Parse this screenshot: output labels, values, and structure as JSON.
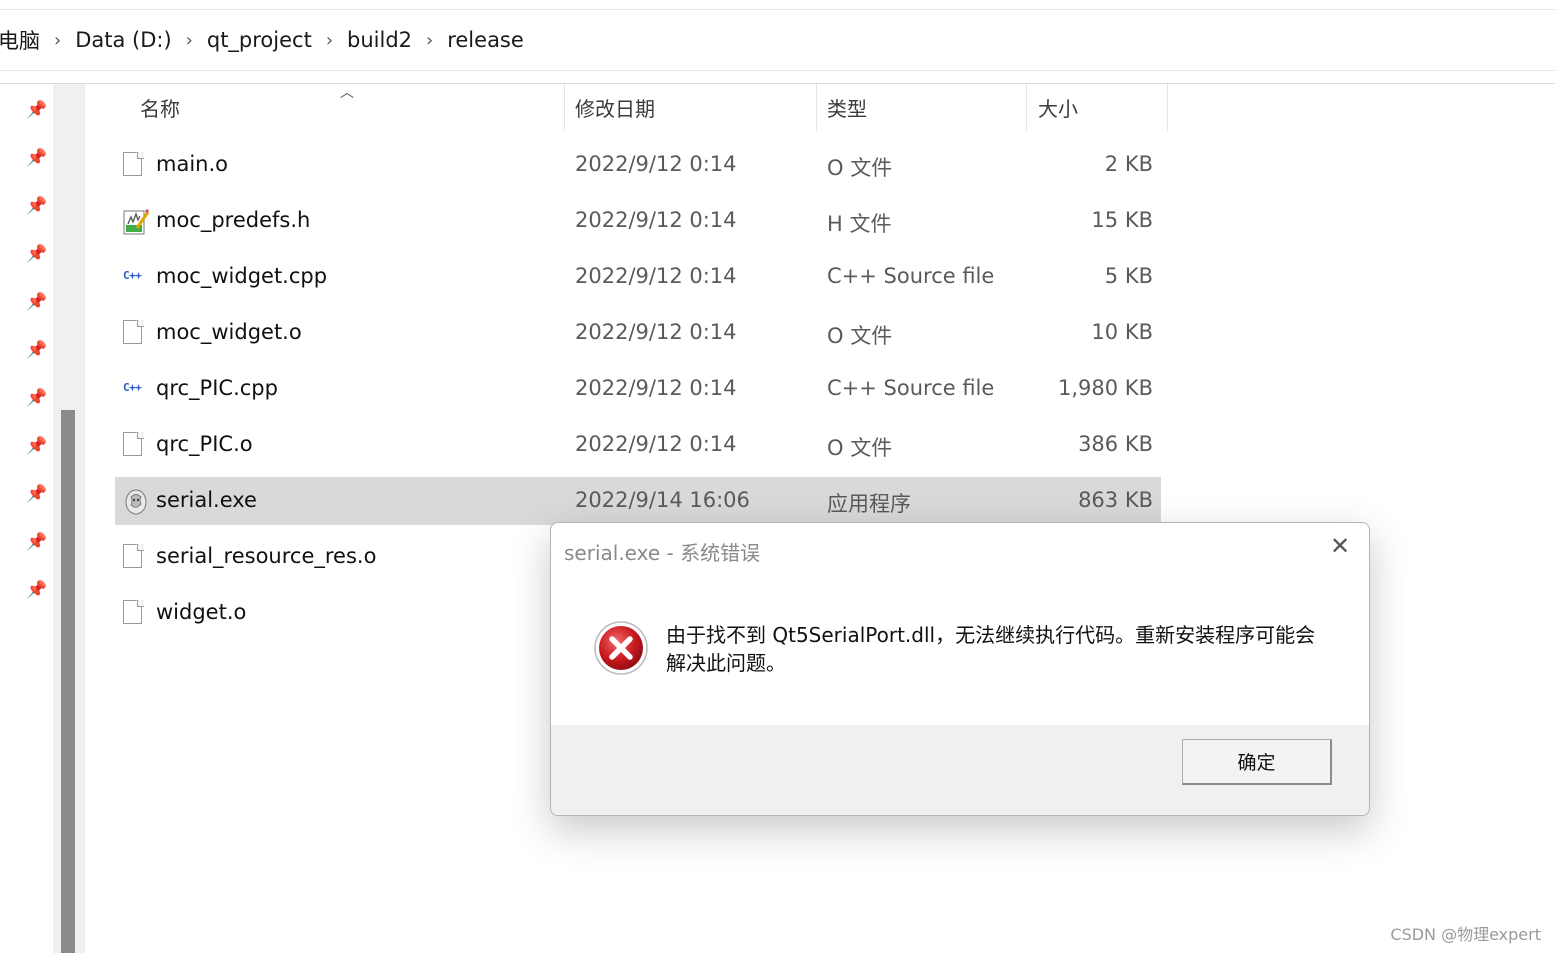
{
  "breadcrumb": {
    "items": [
      "电脑",
      "Data (D:)",
      "qt_project",
      "build2",
      "release"
    ],
    "separator": "›"
  },
  "columns": {
    "name": "名称",
    "modified": "修改日期",
    "type": "类型",
    "size": "大小"
  },
  "files": [
    {
      "name": "main.o",
      "modified": "2022/9/12 0:14",
      "type": "O 文件",
      "size": "2 KB",
      "icon": "generic-file-icon"
    },
    {
      "name": "moc_predefs.h",
      "modified": "2022/9/12 0:14",
      "type": "H 文件",
      "size": "15 KB",
      "icon": "header-file-icon"
    },
    {
      "name": "moc_widget.cpp",
      "modified": "2022/9/12 0:14",
      "type": "C++ Source file",
      "size": "5 KB",
      "icon": "cpp-file-icon"
    },
    {
      "name": "moc_widget.o",
      "modified": "2022/9/12 0:14",
      "type": "O 文件",
      "size": "10 KB",
      "icon": "generic-file-icon"
    },
    {
      "name": "qrc_PIC.cpp",
      "modified": "2022/9/12 0:14",
      "type": "C++ Source file",
      "size": "1,980 KB",
      "icon": "cpp-file-icon"
    },
    {
      "name": "qrc_PIC.o",
      "modified": "2022/9/12 0:14",
      "type": "O 文件",
      "size": "386 KB",
      "icon": "generic-file-icon"
    },
    {
      "name": "serial.exe",
      "modified": "2022/9/14 16:06",
      "type": "应用程序",
      "size": "863 KB",
      "icon": "exe-file-icon",
      "selected": true
    },
    {
      "name": "serial_resource_res.o",
      "modified": "",
      "type": "",
      "size": "",
      "icon": "generic-file-icon"
    },
    {
      "name": "widget.o",
      "modified": "",
      "type": "",
      "size": "",
      "icon": "generic-file-icon"
    }
  ],
  "dialog": {
    "title": "serial.exe - 系统错误",
    "close_label": "✕",
    "message": "由于找不到 Qt5SerialPort.dll，无法继续执行代码。重新安装程序可能会解决此问题。",
    "ok_label": "确定",
    "icon": "error-icon"
  },
  "watermark": "CSDN @物理expert",
  "colors": {
    "selected_row": "#d9d9d9",
    "error_red": "#c8181e",
    "dialog_footer": "#f0f0f0"
  }
}
